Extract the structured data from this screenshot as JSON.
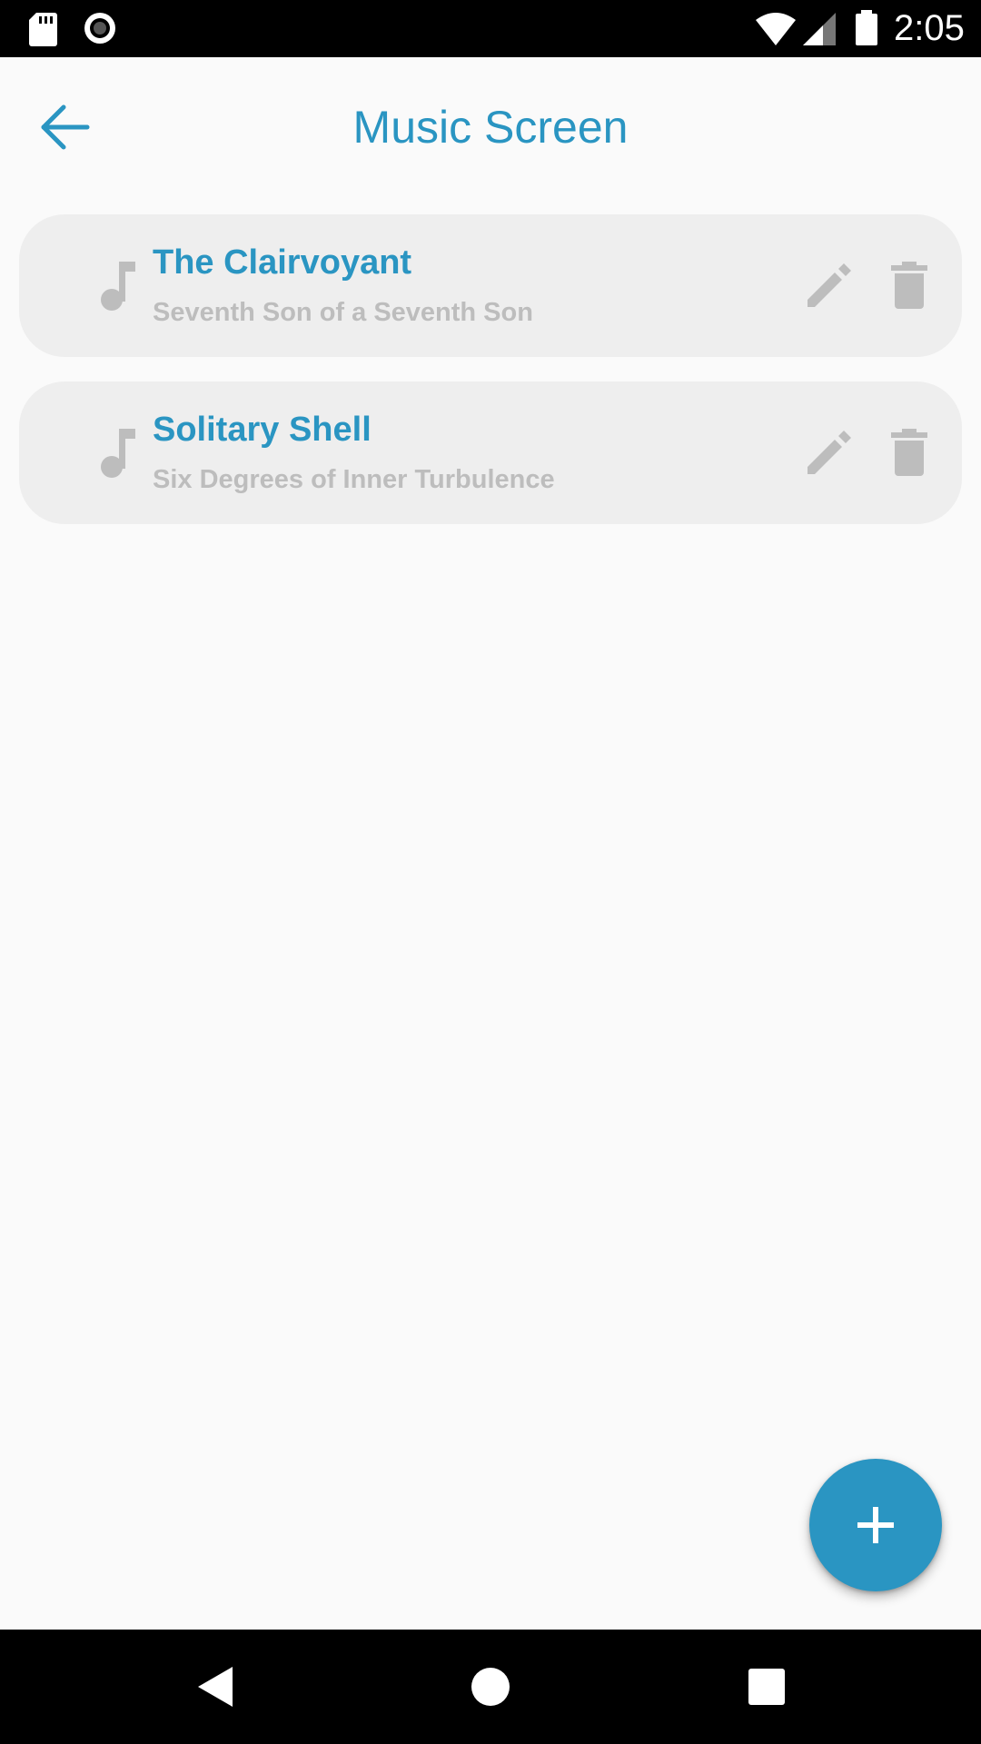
{
  "status_bar": {
    "time": "2:05",
    "icons": [
      "sd-card-icon",
      "record-icon",
      "wifi-icon",
      "signal-icon",
      "battery-icon"
    ]
  },
  "app_bar": {
    "title": "Music Screen",
    "back_icon": "arrow-back-icon"
  },
  "songs": [
    {
      "title": "The Clairvoyant",
      "album": "Seventh Son of a Seventh Son"
    },
    {
      "title": "Solitary Shell",
      "album": "Six Degrees of Inner Turbulence"
    }
  ],
  "fab": {
    "icon": "plus-icon"
  },
  "nav_bar": {
    "icons": [
      "back-triangle-icon",
      "home-circle-icon",
      "recents-square-icon"
    ]
  },
  "colors": {
    "accent": "#2a95c2",
    "background": "#fafafa",
    "card": "#eeeeee",
    "muted_icon": "#bdbdbd",
    "subtitle": "#bdbdbd"
  }
}
